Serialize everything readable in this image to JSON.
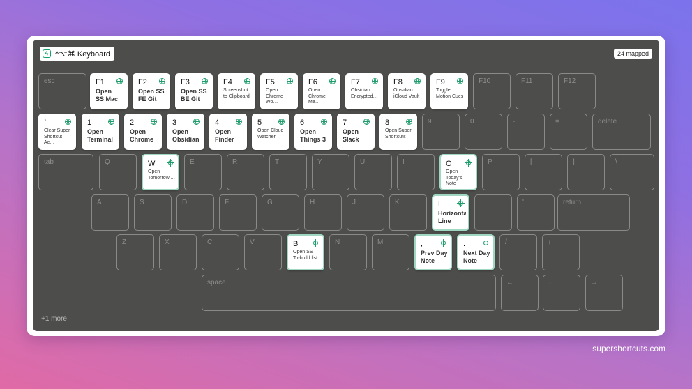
{
  "app": {
    "title": "^⌥⌘ Keyboard",
    "mapped_count": "24 mapped",
    "more": "+1 more",
    "site": "supershortcuts.com",
    "accent_color": "#1f9d6c"
  },
  "keyboard": {
    "rows": [
      [
        {
          "key": "esc"
        },
        {
          "key": "F1",
          "action": "Open\nSS Mac",
          "icon": "globe-icon",
          "size": "big"
        },
        {
          "key": "F2",
          "action": "Open SS\nFE Git",
          "icon": "globe-icon",
          "size": "big"
        },
        {
          "key": "F3",
          "action": "Open SS\nBE Git",
          "icon": "globe-icon",
          "size": "big"
        },
        {
          "key": "F4",
          "action": "Screenshot\nto Clipboard",
          "icon": "globe-icon",
          "size": "small"
        },
        {
          "key": "F5",
          "action": "Open\nChrome Wo…",
          "icon": "globe-icon",
          "size": "small"
        },
        {
          "key": "F6",
          "action": "Open\nChrome Me…",
          "icon": "globe-icon",
          "size": "small"
        },
        {
          "key": "F7",
          "action": "Obsidian\nEncrypted…",
          "icon": "globe-icon",
          "size": "small"
        },
        {
          "key": "F8",
          "action": "Obsidian\niCloud Vault",
          "icon": "globe-icon",
          "size": "small"
        },
        {
          "key": "F9",
          "action": "Toggle\nMotion Cues",
          "icon": "globe-icon",
          "size": "small"
        },
        {
          "key": "F10"
        },
        {
          "key": "F11"
        },
        {
          "key": "F12"
        }
      ],
      [
        {
          "key": "`",
          "action": "Clear Super\nShortcut Ac…",
          "icon": "globe-icon",
          "size": "small"
        },
        {
          "key": "1",
          "action": "Open\nTerminal",
          "icon": "globe-icon",
          "size": "big"
        },
        {
          "key": "2",
          "action": "Open\nChrome",
          "icon": "globe-icon",
          "size": "big"
        },
        {
          "key": "3",
          "action": "Open\nObsidian",
          "icon": "globe-icon",
          "size": "big"
        },
        {
          "key": "4",
          "action": "Open\nFinder",
          "icon": "globe-icon",
          "size": "big"
        },
        {
          "key": "5",
          "action": "Open Cloud\nWatcher",
          "icon": "globe-icon",
          "size": "small"
        },
        {
          "key": "6",
          "action": "Open\nThings 3",
          "icon": "globe-icon",
          "size": "big"
        },
        {
          "key": "7",
          "action": "Open\nSlack",
          "icon": "globe-icon",
          "size": "big"
        },
        {
          "key": "8",
          "action": "Open Super\nShortcuts",
          "icon": "globe-icon",
          "size": "small"
        },
        {
          "key": "9"
        },
        {
          "key": "0"
        },
        {
          "key": "-"
        },
        {
          "key": "="
        },
        {
          "key": "delete"
        }
      ],
      [
        {
          "key": "tab"
        },
        {
          "key": "Q"
        },
        {
          "key": "W",
          "action": "Open\nTomorrow'…",
          "icon": "target-icon",
          "size": "small"
        },
        {
          "key": "E"
        },
        {
          "key": "R"
        },
        {
          "key": "T"
        },
        {
          "key": "Y"
        },
        {
          "key": "U"
        },
        {
          "key": "I"
        },
        {
          "key": "O",
          "action": "Open\nToday's Note",
          "icon": "target-icon",
          "size": "small"
        },
        {
          "key": "P"
        },
        {
          "key": "["
        },
        {
          "key": "]"
        },
        {
          "key": "\\"
        }
      ],
      [
        {
          "key": "A"
        },
        {
          "key": "S"
        },
        {
          "key": "D"
        },
        {
          "key": "F"
        },
        {
          "key": "G"
        },
        {
          "key": "H"
        },
        {
          "key": "J"
        },
        {
          "key": "K"
        },
        {
          "key": "L",
          "action": "Horizontal\nLine",
          "icon": "target-icon",
          "size": "big"
        },
        {
          "key": ";"
        },
        {
          "key": "'"
        },
        {
          "key": "return"
        }
      ],
      [
        {
          "key": "Z"
        },
        {
          "key": "X"
        },
        {
          "key": "C"
        },
        {
          "key": "V"
        },
        {
          "key": "B",
          "action": "Open SS\nTo-build list",
          "icon": "target-icon",
          "size": "small"
        },
        {
          "key": "N"
        },
        {
          "key": "M"
        },
        {
          "key": ",",
          "action": "Prev Day\nNote",
          "icon": "target-icon",
          "size": "big"
        },
        {
          "key": ".",
          "action": "Next Day\nNote",
          "icon": "target-icon",
          "size": "big"
        },
        {
          "key": "/"
        },
        {
          "key": "↑"
        }
      ],
      [
        {
          "key": "space"
        },
        {
          "key": "←"
        },
        {
          "key": "↓"
        },
        {
          "key": "→"
        }
      ]
    ]
  }
}
